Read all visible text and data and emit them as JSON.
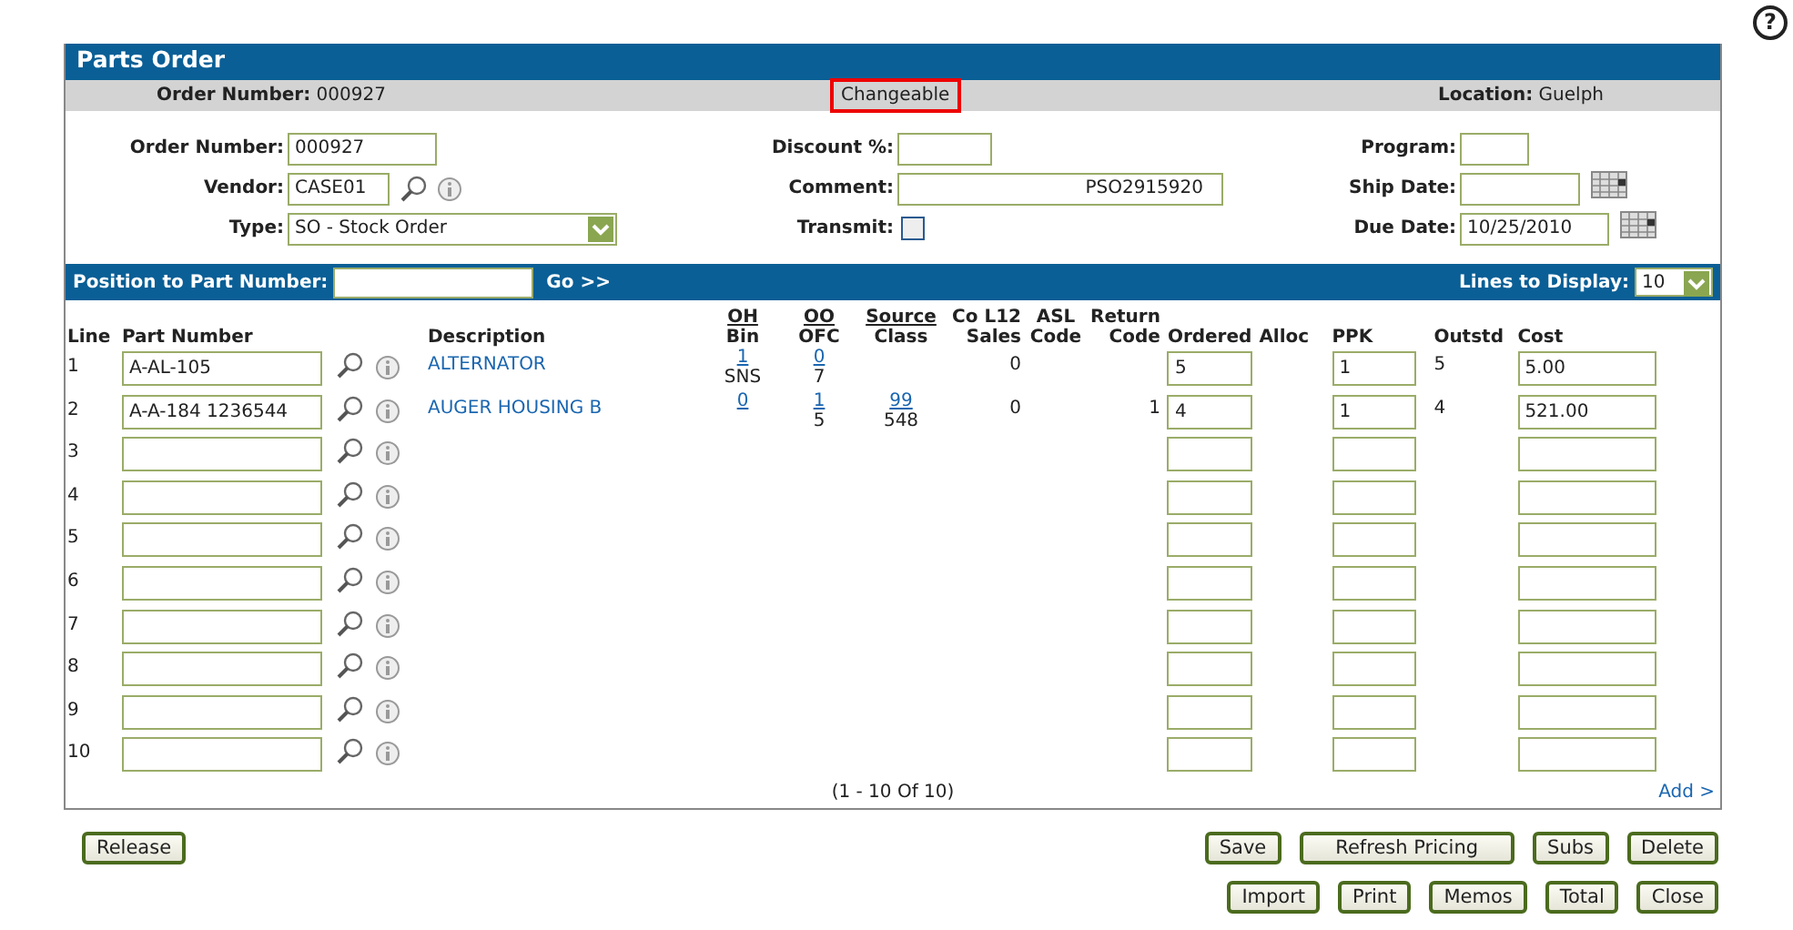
{
  "help": "?",
  "title": "Parts Order",
  "info_bar": {
    "order_label": "Order Number:",
    "order_number": "000927",
    "status": "Changeable",
    "location_label": "Location:",
    "location": "Guelph"
  },
  "form": {
    "columns": [
      [
        {
          "kind": "text",
          "label": "Order Number:",
          "value": "000927"
        },
        {
          "kind": "lookup",
          "label": "Vendor:",
          "value": "CASE01"
        },
        {
          "kind": "select",
          "label": "Type:",
          "value": "SO - Stock Order"
        }
      ],
      [
        {
          "kind": "text",
          "label": "Discount %:"
        },
        {
          "kind": "comment",
          "label": "Comment:",
          "value": "PSO2915920"
        },
        {
          "kind": "checkbox",
          "label": "Transmit:",
          "checked": false
        }
      ],
      [
        {
          "kind": "small",
          "label": "Program:"
        },
        {
          "kind": "date",
          "label": "Ship Date:"
        },
        {
          "kind": "date",
          "label": "Due Date:",
          "value": "10/25/2010"
        }
      ]
    ]
  },
  "position_bar": {
    "label": "Position to Part Number:",
    "go": "Go >>",
    "lines_label": "Lines to Display:",
    "lines_value": "10"
  },
  "table": {
    "columns": [
      {
        "lines": [
          "Line"
        ],
        "underlined": false
      },
      {
        "lines": [
          "Part Number"
        ],
        "underlined": false
      },
      {
        "lines": [
          "Description"
        ],
        "underlined": false
      },
      {
        "lines": [
          "OH",
          "Bin"
        ],
        "underlined": true
      },
      {
        "lines": [
          "OO",
          "OFC"
        ],
        "underlined": true
      },
      {
        "lines": [
          "Source",
          "Class"
        ],
        "underlined": true
      },
      {
        "lines": [
          "Co L12",
          "Sales"
        ],
        "underlined": false
      },
      {
        "lines": [
          "ASL",
          "Code"
        ],
        "underlined": false
      },
      {
        "lines": [
          "Return",
          "Code"
        ],
        "underlined": false
      },
      {
        "lines": [
          "Ordered"
        ],
        "underlined": false
      },
      {
        "lines": [
          "Alloc"
        ],
        "underlined": false
      },
      {
        "lines": [
          "PPK"
        ],
        "underlined": false
      },
      {
        "lines": [
          "Outstd"
        ],
        "underlined": false
      },
      {
        "lines": [
          "Cost"
        ],
        "underlined": false
      }
    ],
    "rows": [
      {
        "line": "1",
        "part": "A-AL-105",
        "description": "ALTERNATOR",
        "oh": "1",
        "bin": "SNS",
        "oo": "0",
        "ofc": "7",
        "sales": "0",
        "ordered": "5",
        "ppk": "1",
        "outstd": "5",
        "cost": "5.00"
      },
      {
        "line": "2",
        "part": "A-A-184 1236544",
        "description": "AUGER HOUSING B",
        "oh": "0",
        "oo": "1",
        "ofc": "5",
        "source": "99",
        "class": "548",
        "sales": "0",
        "return": "1",
        "ordered": "4",
        "ppk": "1",
        "outstd": "4",
        "cost": "521.00"
      },
      {
        "line": "3"
      },
      {
        "line": "4"
      },
      {
        "line": "5"
      },
      {
        "line": "6"
      },
      {
        "line": "7"
      },
      {
        "line": "8"
      },
      {
        "line": "9"
      },
      {
        "line": "10"
      }
    ],
    "range": "(1  -  10  Of  10)",
    "add": "Add >"
  },
  "buttons": {
    "left": [
      "Release"
    ],
    "right_top": [
      "Save",
      "Refresh Pricing",
      "Subs",
      "Delete"
    ],
    "right_bottom": [
      "Import",
      "Print",
      "Memos",
      "Total",
      "Close"
    ]
  }
}
